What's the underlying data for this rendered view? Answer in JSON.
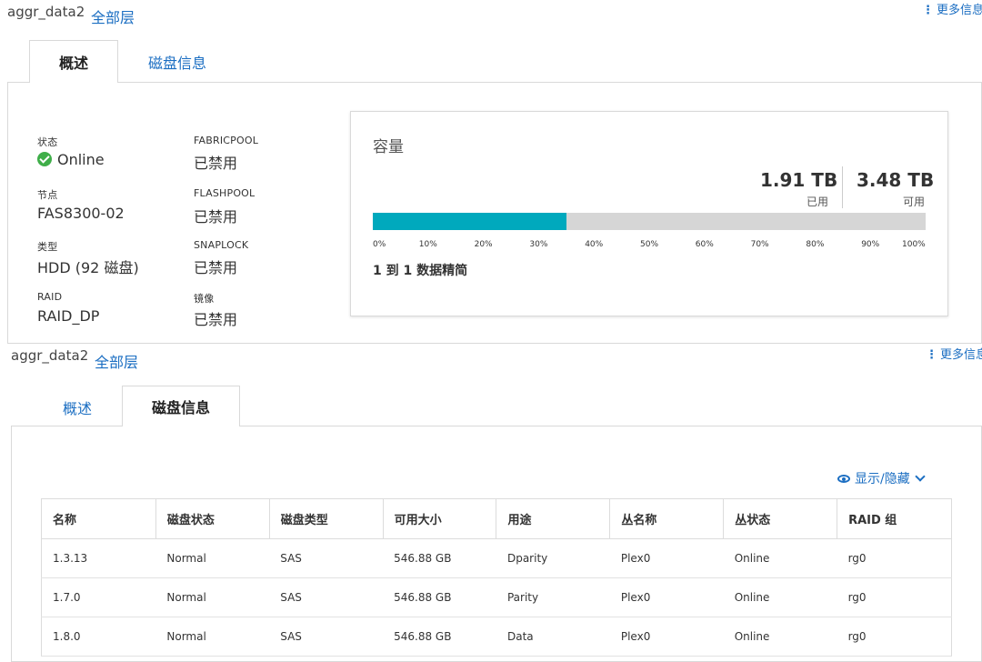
{
  "top": {
    "aggr_name": "aggr_data2",
    "tier_link": "全部层",
    "more_info": "更多信息",
    "tabs": [
      {
        "label": "概述",
        "active": true
      },
      {
        "label": "磁盘信息",
        "active": false
      }
    ],
    "fields": {
      "status_label": "状态",
      "status_value": "Online",
      "node_label": "节点",
      "node_value": "FAS8300-02",
      "type_label": "类型",
      "type_value": "HDD (92 磁盘)",
      "raid_label": "RAID",
      "raid_value": "RAID_DP",
      "fabricpool_label": "FABRICPOOL",
      "fabricpool_value": "已禁用",
      "flashpool_label": "FLASHPOOL",
      "flashpool_value": "已禁用",
      "snaplock_label": "SNAPLOCK",
      "snaplock_value": "已禁用",
      "mirror_label": "镜像",
      "mirror_value": "已禁用"
    },
    "capacity": {
      "title": "容量",
      "used_value": "1.91 TB",
      "used_label": "已用",
      "available_value": "3.48 TB",
      "available_label": "可用",
      "used_fraction": 0.35,
      "ticks": [
        "0%",
        "10%",
        "20%",
        "30%",
        "40%",
        "50%",
        "60%",
        "70%",
        "80%",
        "90%",
        "100%"
      ],
      "note": "1 到 1 数据精简"
    }
  },
  "bottom": {
    "aggr_name": "aggr_data2",
    "tier_link": "全部层",
    "more_info": "更多信息",
    "tabs": [
      {
        "label": "概述",
        "active": false
      },
      {
        "label": "磁盘信息",
        "active": true
      }
    ],
    "show_hide": "显示/隐藏",
    "table": {
      "columns": [
        "名称",
        "磁盘状态",
        "磁盘类型",
        "可用大小",
        "用途",
        "丛名称",
        "丛状态",
        "RAID 组"
      ],
      "rows": [
        [
          "1.3.13",
          "Normal",
          "SAS",
          "546.88 GB",
          "Dparity",
          "Plex0",
          "Online",
          "rg0"
        ],
        [
          "1.7.0",
          "Normal",
          "SAS",
          "546.88 GB",
          "Parity",
          "Plex0",
          "Online",
          "rg0"
        ],
        [
          "1.8.0",
          "Normal",
          "SAS",
          "546.88 GB",
          "Data",
          "Plex0",
          "Online",
          "rg0"
        ]
      ]
    }
  },
  "colors": {
    "accent": "#1b6ec2",
    "bar_fill": "#00a9bd",
    "bar_track": "#d6d6d6",
    "status_ok": "#3fae49"
  }
}
